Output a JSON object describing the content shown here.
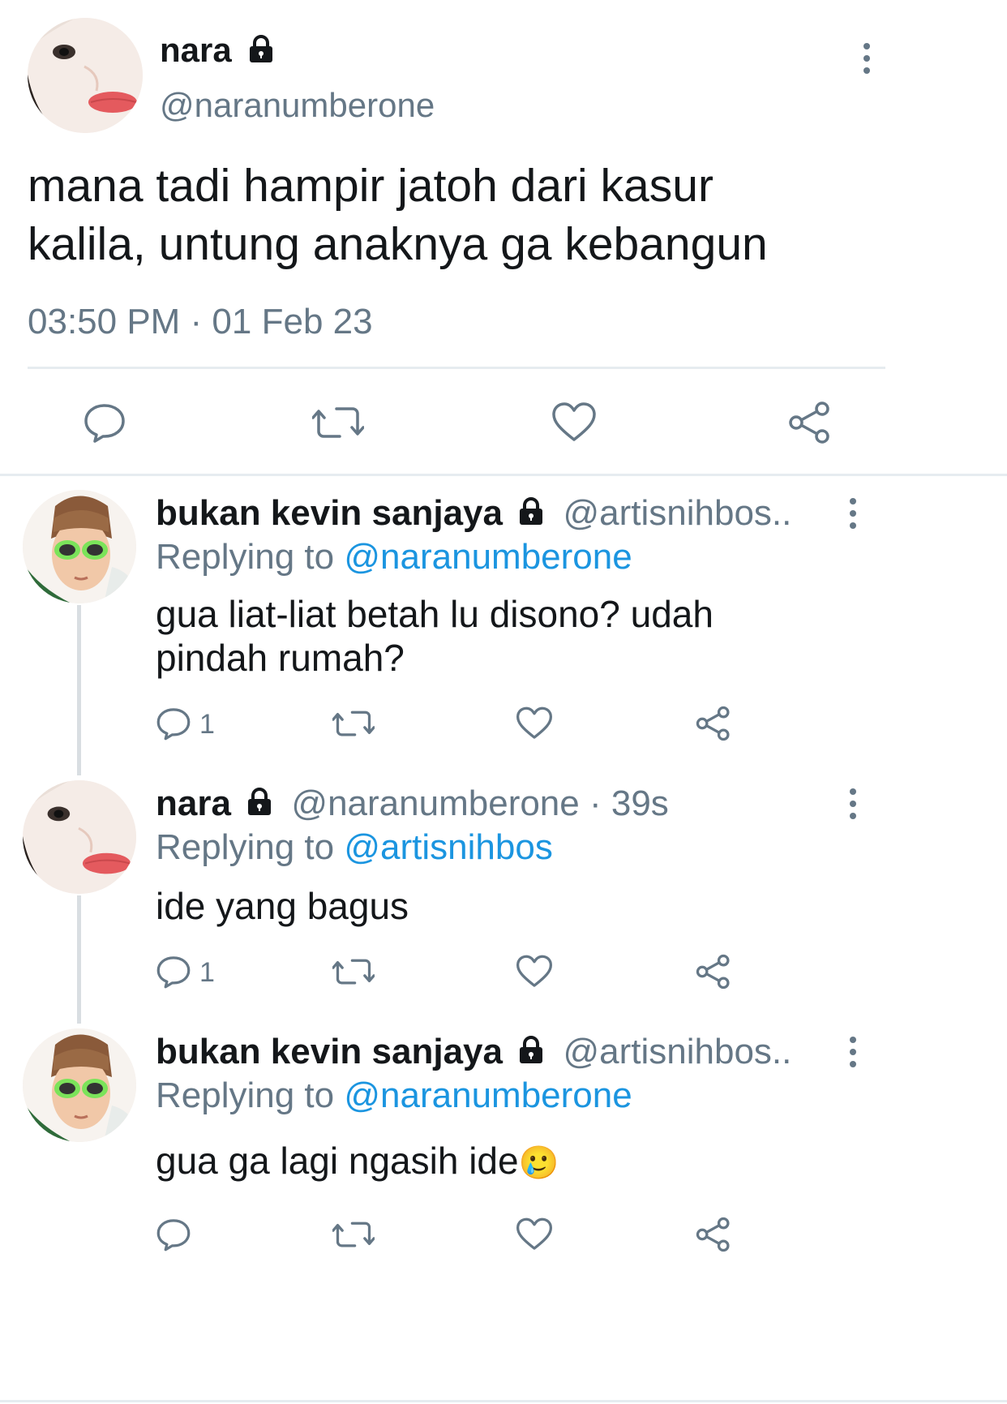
{
  "main_tweet": {
    "author_name": "nara",
    "author_handle": "@naranumberone",
    "text_line1": "mana tadi hampir jatoh dari kasur",
    "text_line2": "kalila, untung anaknya ga kebangun",
    "timestamp": "03:50 PM · 01 Feb 23"
  },
  "replies": [
    {
      "author_name": "bukan kevin sanjaya",
      "author_handle": "@artisnihbos..",
      "replying_label": "Replying to",
      "replying_to": "@naranumberone",
      "text_line1": "gua liat-liat betah lu disono? udah",
      "text_line2": "pindah rumah?",
      "reply_count": "1"
    },
    {
      "author_name": "nara",
      "author_handle": "@naranumberone · 39s",
      "replying_label": "Replying to",
      "replying_to": "@artisnihbos",
      "text_line1": "ide yang bagus",
      "reply_count": "1"
    },
    {
      "author_name": "bukan kevin sanjaya",
      "author_handle": "@artisnihbos..",
      "replying_label": "Replying to",
      "replying_to": "@naranumberone",
      "text_line1": "gua ga lagi ngasih ide",
      "emoji": "🥲"
    }
  ],
  "icons": {
    "reply": "reply-icon",
    "retweet": "retweet-icon",
    "like": "heart-icon",
    "share": "share-icon",
    "more": "more-options-icon",
    "lock": "lock-icon"
  },
  "colors": {
    "text": "#14171a",
    "secondary": "#657786",
    "link": "#1b95e0",
    "divider": "#e6ecf0"
  }
}
